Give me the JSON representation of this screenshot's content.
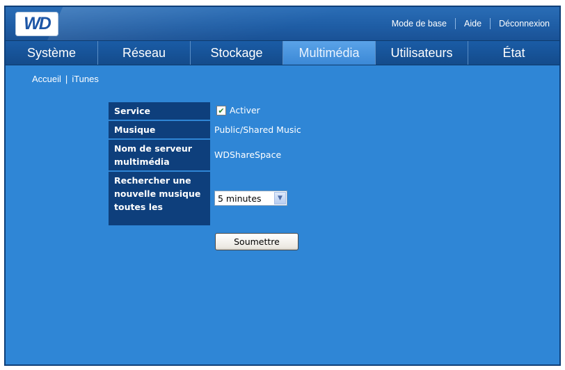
{
  "header": {
    "logo_text": "WD",
    "links": {
      "basic_mode": "Mode de base",
      "help": "Aide",
      "logout": "Déconnexion"
    }
  },
  "nav": {
    "tabs": [
      {
        "label": "Système",
        "active": false
      },
      {
        "label": "Réseau",
        "active": false
      },
      {
        "label": "Stockage",
        "active": false
      },
      {
        "label": "Multimédia",
        "active": true
      },
      {
        "label": "Utilisateurs",
        "active": false
      },
      {
        "label": "État",
        "active": false
      }
    ]
  },
  "breadcrumb": {
    "home": "Accueil",
    "current": "iTunes"
  },
  "form": {
    "service": {
      "label": "Service",
      "checkbox_label": "Activer",
      "checked": true
    },
    "music": {
      "label": "Musique",
      "value": "Public/Shared Music"
    },
    "server_name": {
      "label": "Nom de serveur multimédia",
      "value": "WDShareSpace"
    },
    "rescan": {
      "label": "Rechercher une nouvelle musique toutes les",
      "selected": "5 minutes"
    },
    "submit_label": "Soumettre"
  },
  "colors": {
    "background": "#2f86d6",
    "label_bg": "#0e3f7c",
    "active_tab": "#4a96de"
  },
  "icons": {
    "checkbox": "checkmark-icon",
    "select": "chevron-down-icon"
  }
}
